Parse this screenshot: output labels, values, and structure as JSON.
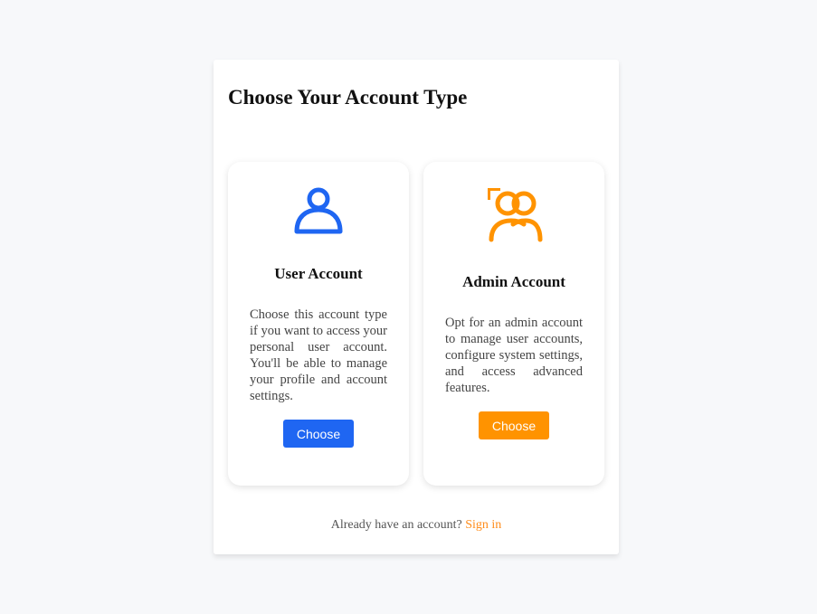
{
  "page": {
    "title": "Choose Your Account Type"
  },
  "cards": {
    "user": {
      "icon": "user-icon",
      "title": "User Account",
      "description": "Choose this account type if you want to access your personal user account. You'll be able to manage your profile and account settings.",
      "button_label": "Choose",
      "accent": "#1f66f2"
    },
    "admin": {
      "icon": "users-icon",
      "title": "Admin Account",
      "description": "Opt for an admin account to manage user accounts, configure system settings, and access advanced features.",
      "button_label": "Choose",
      "accent": "#ff9300"
    }
  },
  "footer": {
    "prompt": "Already have an account?",
    "link_label": "Sign in",
    "link_color": "#ff8c1a"
  }
}
